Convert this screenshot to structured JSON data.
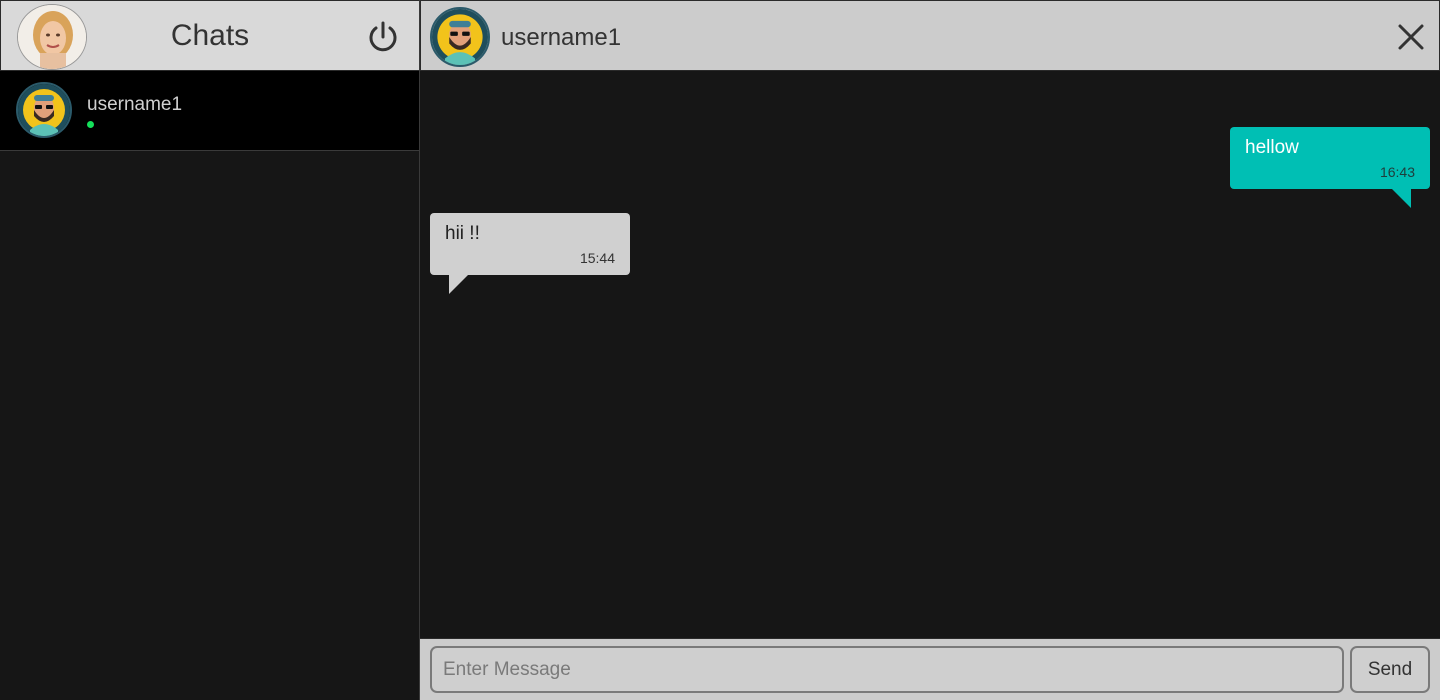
{
  "sidebar": {
    "title": "Chats",
    "chats": [
      {
        "username": "username1",
        "status": "online",
        "status_color": "#14e05a"
      }
    ]
  },
  "conversation": {
    "username": "username1",
    "messages": [
      {
        "direction": "sent",
        "text": "hellow",
        "time": "16:43"
      },
      {
        "direction": "received",
        "text": "hii !!",
        "time": "15:44"
      }
    ]
  },
  "composer": {
    "placeholder": "Enter Message",
    "send_label": "Send"
  },
  "icons": {
    "logout": "power-icon",
    "close": "close-icon"
  },
  "colors": {
    "accent": "#00bfb4",
    "background": "#161616",
    "header": "#cccccc",
    "online": "#14e05a"
  }
}
